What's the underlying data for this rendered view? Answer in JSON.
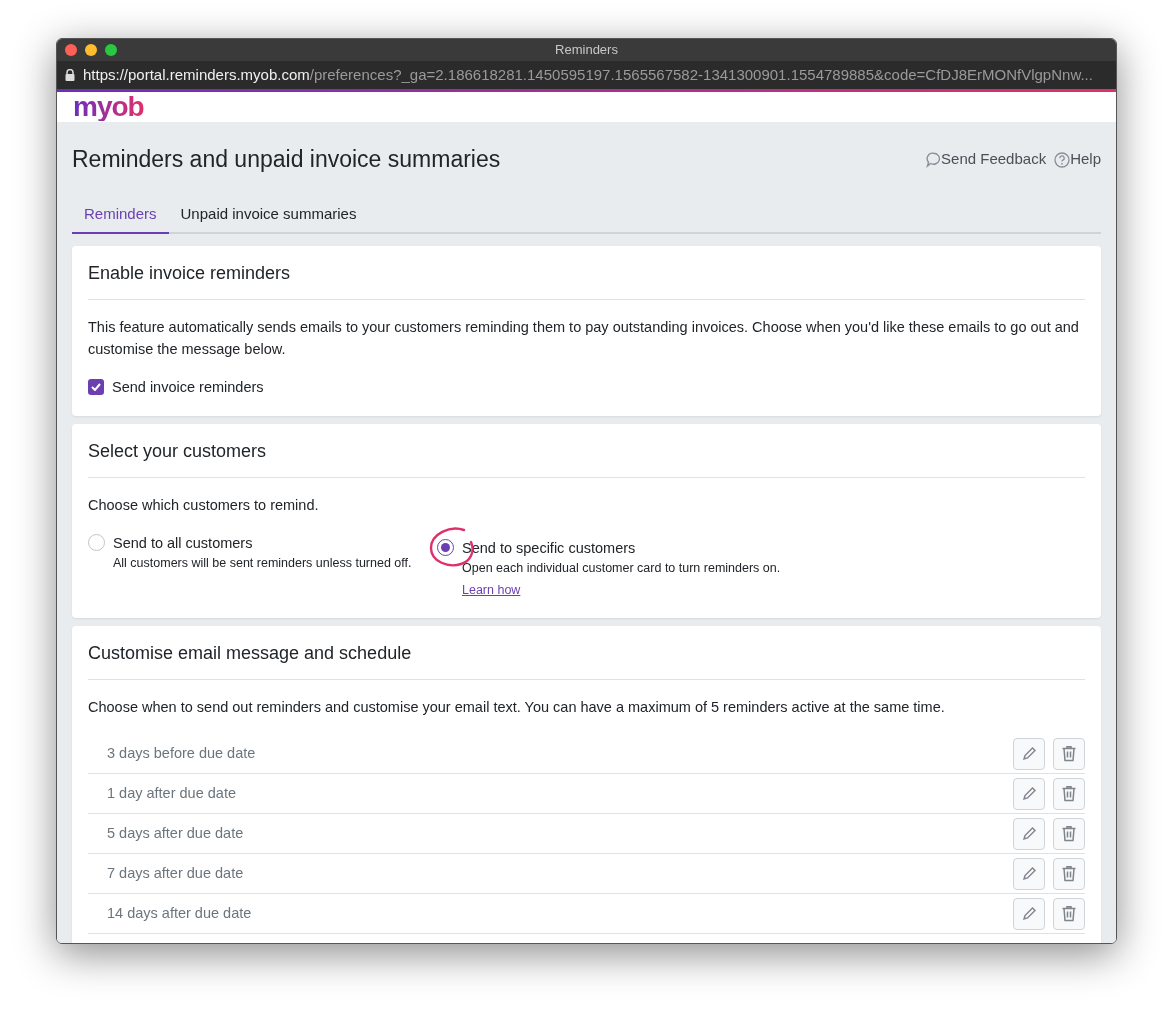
{
  "window": {
    "title": "Reminders",
    "url_host": "https://portal.reminders.myob.com",
    "url_rest": "/preferences?_ga=2.186618281.1450595197.1565567582-1341300901.1554789885&code=CfDJ8ErMONfVlgpNnw..."
  },
  "logo": "myob",
  "page": {
    "title": "Reminders and unpaid invoice summaries",
    "links": [
      "Send Feedback",
      "Help"
    ]
  },
  "tabs": [
    {
      "label": "Reminders",
      "selected": true
    },
    {
      "label": "Unpaid invoice summaries",
      "selected": false
    }
  ],
  "enable_card": {
    "title": "Enable invoice reminders",
    "text": "This feature automatically sends emails to your customers reminding them to pay outstanding invoices. Choose when you'd like these emails to go out and customise the message below.",
    "checkbox": {
      "label": "Send invoice reminders",
      "checked": true
    }
  },
  "customers_card": {
    "title": "Select your customers",
    "text": "Choose which customers to remind.",
    "options": [
      {
        "label": "Send to all customers",
        "hint": "All customers will be sent reminders unless turned off.",
        "selected": false
      },
      {
        "label": "Send to specific customers",
        "hint": "Open each individual customer card to turn reminders on.",
        "link": "Learn how",
        "selected": true
      }
    ]
  },
  "schedule_card": {
    "title": "Customise email message and schedule",
    "text": "Choose when to send out reminders and customise your email text. You can have a maximum of 5 reminders active at the same time.",
    "reminders": [
      {
        "label": "3 days before due date"
      },
      {
        "label": "1 day after due date"
      },
      {
        "label": "5 days after due date"
      },
      {
        "label": "7 days after due date"
      },
      {
        "label": "14 days after due date"
      }
    ]
  }
}
